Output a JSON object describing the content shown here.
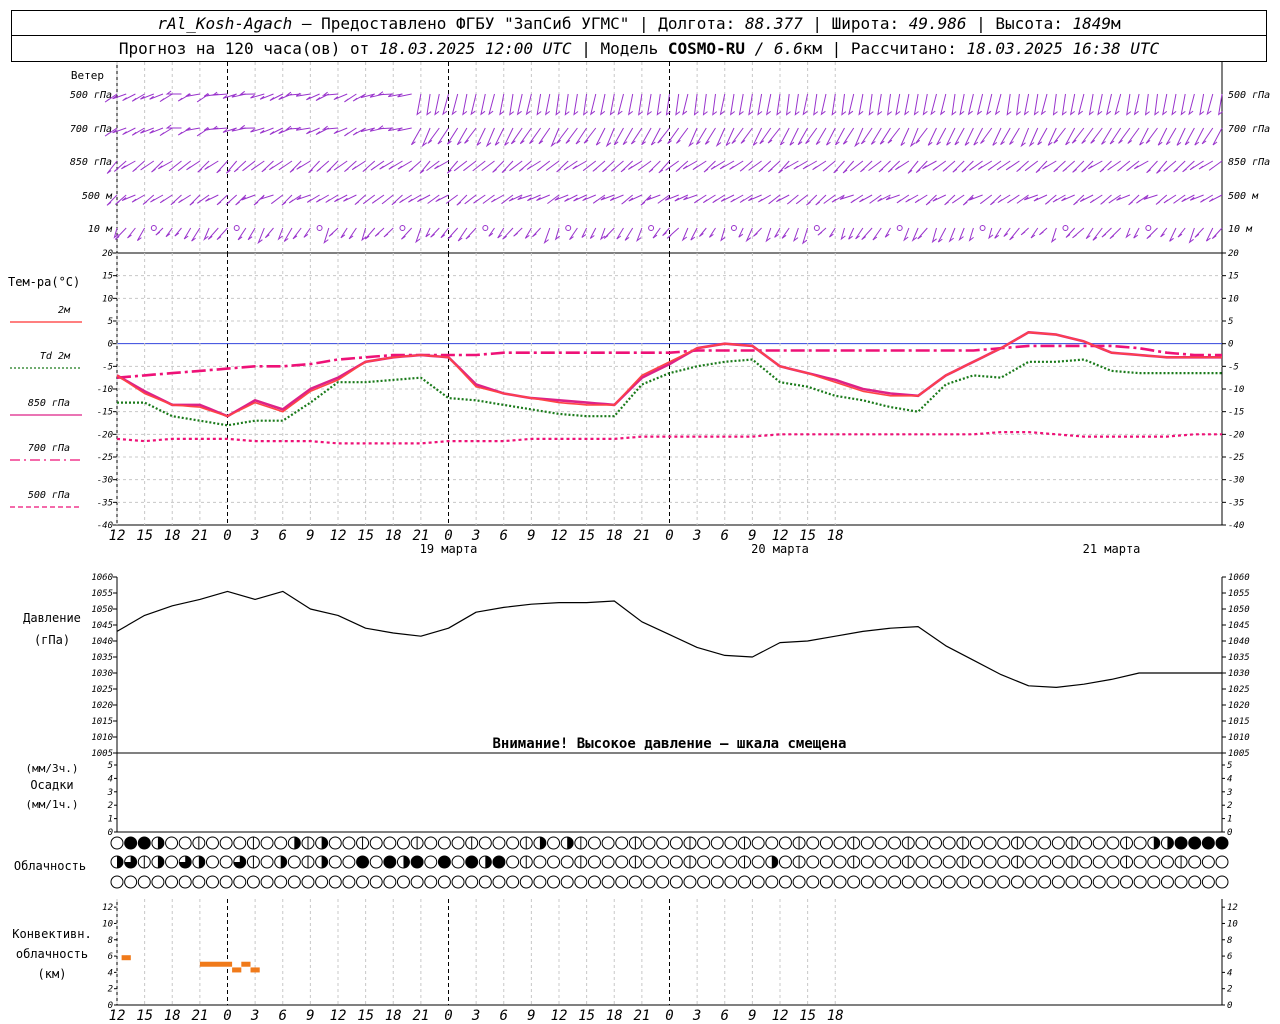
{
  "header": {
    "station_name": "rAl_Kosh-Agach",
    "provider": " – Предоставлено ФГБУ \"ЗапСиб УГМС\" | Долгота: ",
    "lon": "88.377",
    "lat_label": " | Широта: ",
    "lat": "49.986",
    "alt_label": " | Высота: ",
    "alt": "1849",
    "alt_unit": "м",
    "forecast_label": "Прогноз на 120 часа(ов) от ",
    "forecast_date": "18.03.2025 12:00 UTC",
    "model_label": "  | Модель ",
    "model_name": "COSMO-RU",
    "model_res": " / 6.6",
    "model_res_unit": "км",
    "calc_label": " | Рассчитано: ",
    "calc_date": "18.03.2025 16:38 UTC"
  },
  "wind_panel": {
    "title": "Ветер",
    "levels": [
      "500 гПа",
      "700 гПа",
      "850 гПа",
      "500 м",
      "10 м"
    ],
    "color": "#9933cc"
  },
  "temp_panel": {
    "title": "Тем-ра(°С)",
    "legend": [
      {
        "label": "2м",
        "color": "#ff3333",
        "style": "solid"
      },
      {
        "label": "Td  2м",
        "color": "#1a7a1a",
        "style": "dotted"
      },
      {
        "label": "850 гПа",
        "color": "#dd2288",
        "style": "solid"
      },
      {
        "label": "700 гПа",
        "color": "#ee1177",
        "style": "dashdot"
      },
      {
        "label": "500 гПа",
        "color": "#ee1177",
        "style": "dashed"
      }
    ],
    "ticks": [
      "20",
      "15",
      "10",
      "5",
      "0",
      "-5",
      "-10",
      "-15",
      "-20",
      "-25",
      "-30",
      "-35",
      "-40"
    ]
  },
  "time_axis": {
    "labels": [
      "12",
      "15",
      "18",
      "21",
      "0",
      "3",
      "6",
      "9",
      "12",
      "15",
      "18",
      "21",
      "0",
      "3",
      "6",
      "9",
      "12",
      "15",
      "18",
      "21",
      "0",
      "3",
      "6",
      "9",
      "12",
      "15",
      "18"
    ],
    "dates": [
      "19 марта",
      "20 марта",
      "21 марта"
    ]
  },
  "pressure_panel": {
    "title": "Давление",
    "unit": "(гПа)",
    "ticks": [
      "1060",
      "1055",
      "1050",
      "1045",
      "1040",
      "1035",
      "1030",
      "1025",
      "1020",
      "1015",
      "1010",
      "1005"
    ],
    "warning": "Внимание! Высокое давление – шкала смещена"
  },
  "precip_panel": {
    "unit3": "(мм/3ч.)",
    "title": "Осадки",
    "unit1": "(мм/1ч.)",
    "ticks": [
      "5",
      "4",
      "3",
      "2",
      "1",
      "0"
    ]
  },
  "cloud_panel": {
    "title": "Облачность"
  },
  "conv_panel": {
    "title1": "Конвективн.",
    "title2": "облачность",
    "unit": "(км)",
    "ticks": [
      "12",
      "10",
      "8",
      "6",
      "4",
      "2",
      "0"
    ]
  },
  "chart_data": [
    {
      "type": "line",
      "title": "Тем-ра(°С)",
      "ylim": [
        -40,
        20
      ],
      "x_hours": [
        0,
        3,
        6,
        9,
        12,
        15,
        18,
        21,
        24,
        27,
        30,
        33,
        36,
        39,
        42,
        45,
        48,
        51,
        54,
        57,
        60,
        63,
        66,
        69,
        72,
        75,
        78,
        81,
        84,
        87,
        90,
        93,
        96,
        99,
        102,
        105,
        108,
        111,
        114,
        117,
        120
      ],
      "series": [
        {
          "name": "2м",
          "values": [
            -7,
            -11,
            -13.5,
            -14,
            -16,
            -13,
            -15,
            -10.5,
            -8,
            -4,
            -3,
            -2.5,
            -3,
            -9.5,
            -11,
            -12,
            -13,
            -13.5,
            -13.5,
            -7,
            -4,
            -1,
            0,
            -0.5,
            -5,
            -6.5,
            -8.5,
            -10.5,
            -11.5,
            -11.5,
            -7,
            -4,
            -1,
            2.5,
            2,
            0.5,
            -2,
            -2.5,
            -3,
            -3,
            -3
          ]
        },
        {
          "name": "Td  2м",
          "values": [
            -13,
            -13,
            -16,
            -17,
            -18,
            -17,
            -17,
            -13,
            -8.5,
            -8.5,
            -8,
            -7.5,
            -12,
            -12.5,
            -13.5,
            -14.5,
            -15.5,
            -16,
            -16,
            -9,
            -6.5,
            -5,
            -4,
            -3.5,
            -8.5,
            -9.5,
            -11.5,
            -12.5,
            -14,
            -15,
            -9,
            -7,
            -7.5,
            -4,
            -4,
            -3.5,
            -6,
            -6.5,
            -6.5,
            -6.5,
            -6.5
          ]
        },
        {
          "name": "850 гПа",
          "values": [
            -7,
            -10.5,
            -13.5,
            -13.5,
            -16,
            -12.5,
            -14.5,
            -10,
            -7.5,
            -4,
            -3,
            -2.5,
            -3,
            -9,
            -11,
            -12,
            -12.5,
            -13,
            -13.5,
            -7.5,
            -4.5,
            -1,
            0,
            -0.5,
            -5,
            -6.5,
            -8,
            -10,
            -11,
            -11.5,
            -7,
            -4,
            -1,
            2.5,
            2,
            0.5,
            -2,
            -2.5,
            -3,
            -3,
            -3
          ]
        },
        {
          "name": "700 гПа",
          "values": [
            -7.5,
            -7,
            -6.5,
            -6,
            -5.5,
            -5,
            -5,
            -4.5,
            -3.5,
            -3,
            -2.5,
            -2.5,
            -2.5,
            -2.5,
            -2,
            -2,
            -2,
            -2,
            -2,
            -2,
            -2,
            -1.5,
            -1.5,
            -1.5,
            -1.5,
            -1.5,
            -1.5,
            -1.5,
            -1.5,
            -1.5,
            -1.5,
            -1.5,
            -1,
            -0.5,
            -0.5,
            -0.5,
            -0.5,
            -1,
            -2,
            -2.5,
            -2.5
          ]
        },
        {
          "name": "500 гПа",
          "values": [
            -21,
            -21.5,
            -21,
            -21,
            -21,
            -21.5,
            -21.5,
            -21.5,
            -22,
            -22,
            -22,
            -22,
            -21.5,
            -21.5,
            -21.5,
            -21,
            -21,
            -21,
            -21,
            -20.5,
            -20.5,
            -20.5,
            -20.5,
            -20.5,
            -20,
            -20,
            -20,
            -20,
            -20,
            -20,
            -20,
            -20,
            -19.5,
            -19.5,
            -20,
            -20.5,
            -20.5,
            -20.5,
            -20.5,
            -20,
            -20
          ]
        }
      ]
    },
    {
      "type": "line",
      "title": "Давление",
      "ylabel": "(гПа)",
      "ylim": [
        1005,
        1060
      ],
      "x_hours": [
        0,
        3,
        6,
        9,
        12,
        15,
        18,
        21,
        24,
        27,
        30,
        33,
        36,
        39,
        42,
        45,
        48,
        51,
        54,
        57,
        60,
        63,
        66,
        69,
        72,
        75,
        78,
        81,
        84,
        87,
        90,
        93,
        96,
        99,
        102,
        105,
        108,
        111,
        114,
        117,
        120
      ],
      "values": [
        1043,
        1048,
        1051,
        1053,
        1055.5,
        1053,
        1055.5,
        1050,
        1048,
        1044,
        1042.5,
        1041.5,
        1044,
        1049,
        1050.5,
        1051.5,
        1052,
        1052,
        1052.5,
        1046,
        1042,
        1038,
        1035.5,
        1035,
        1039.5,
        1040,
        1041.5,
        1043,
        1044,
        1044.5,
        1038.5,
        1034,
        1029.5,
        1026,
        1025.5,
        1026.5,
        1028,
        1030,
        1030,
        1030,
        1030
      ]
    },
    {
      "type": "bar",
      "title": "Конвективн. облачность",
      "ylabel": "(км)",
      "ylim": [
        0,
        13
      ],
      "segments": [
        {
          "from_h": 0.5,
          "to_h": 1.5,
          "km": 5.8
        },
        {
          "from_h": 9,
          "to_h": 12.5,
          "km": 5.0
        },
        {
          "from_h": 12.5,
          "to_h": 13.5,
          "km": 4.3
        },
        {
          "from_h": 13.5,
          "to_h": 14.5,
          "km": 5.0
        },
        {
          "from_h": 14.5,
          "to_h": 15.5,
          "km": 4.3
        }
      ]
    }
  ]
}
